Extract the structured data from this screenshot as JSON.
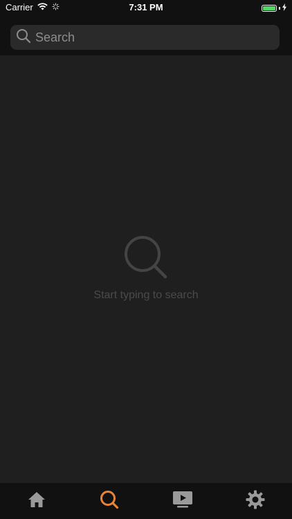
{
  "status_bar": {
    "carrier": "Carrier",
    "time": "7:31 PM",
    "battery_color": "#4cd964"
  },
  "search": {
    "placeholder": "Search",
    "value": ""
  },
  "empty_state": {
    "message": "Start typing to search",
    "icon": "search-icon"
  },
  "tab_bar": {
    "active_color": "#e8833a",
    "inactive_color": "#9a9a9a",
    "tabs": [
      {
        "icon": "home-icon",
        "active": false
      },
      {
        "icon": "search-icon",
        "active": true
      },
      {
        "icon": "play-icon",
        "active": false
      },
      {
        "icon": "gear-icon",
        "active": false
      }
    ]
  }
}
